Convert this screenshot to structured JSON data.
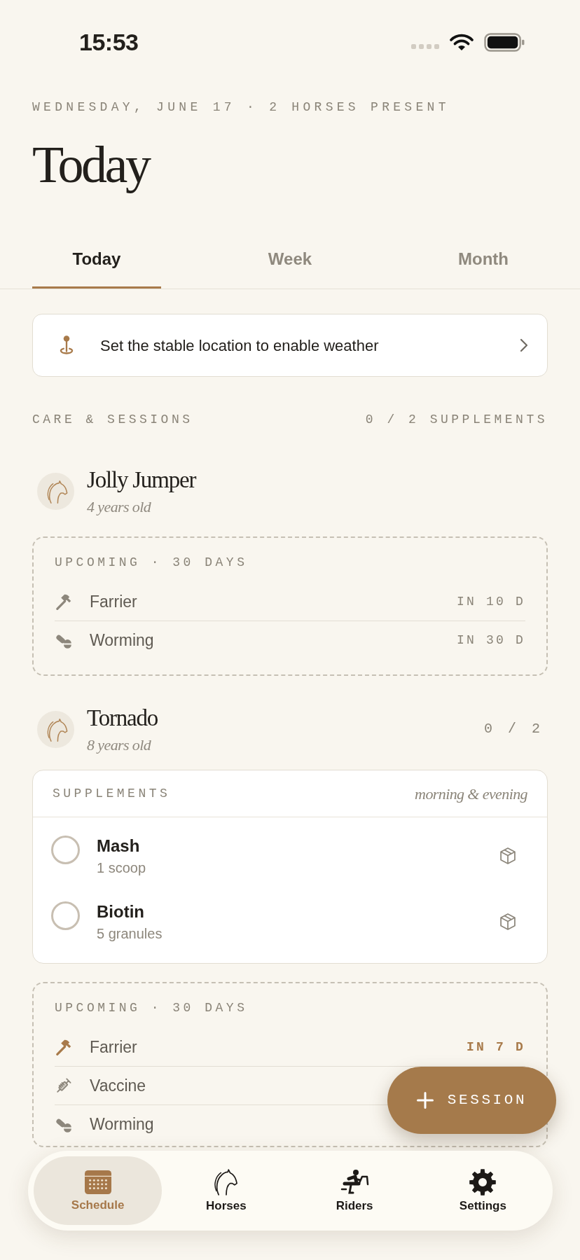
{
  "status_bar": {
    "time": "15:53"
  },
  "header": {
    "date_line": "WEDNESDAY, JUNE 17 · 2 HORSES PRESENT",
    "title": "Today"
  },
  "tabs": [
    {
      "label": "Today",
      "selected": true
    },
    {
      "label": "Week",
      "selected": false
    },
    {
      "label": "Month",
      "selected": false
    }
  ],
  "location_banner": {
    "text": "Set the stable location to enable weather"
  },
  "section": {
    "title": "CARE & SESSIONS",
    "summary": "0 / 2 SUPPLEMENTS"
  },
  "horses": [
    {
      "name": "Jolly Jumper",
      "age": "4 years old",
      "upcoming": {
        "title": "UPCOMING · 30 DAYS",
        "items": [
          {
            "kind": "farrier",
            "label": "Farrier",
            "due": "IN 10 D",
            "urgent": false
          },
          {
            "kind": "worming",
            "label": "Worming",
            "due": "IN 30 D",
            "urgent": false
          }
        ]
      }
    },
    {
      "name": "Tornado",
      "age": "8 years old",
      "count": "0 / 2",
      "supplements": {
        "title": "SUPPLEMENTS",
        "schedule": "morning & evening",
        "items": [
          {
            "name": "Mash",
            "amount": "1 scoop",
            "checked": false
          },
          {
            "name": "Biotin",
            "amount": "5 granules",
            "checked": false
          }
        ]
      },
      "upcoming": {
        "title": "UPCOMING · 30 DAYS",
        "items": [
          {
            "kind": "farrier",
            "label": "Farrier",
            "due": "IN 7 D",
            "urgent": true
          },
          {
            "kind": "vaccine",
            "label": "Vaccine",
            "urgent": false
          },
          {
            "kind": "worming",
            "label": "Worming",
            "urgent": false
          }
        ]
      }
    }
  ],
  "fab": {
    "label": "SESSION"
  },
  "tab_bar": [
    {
      "kind": "schedule",
      "label": "Schedule",
      "selected": true
    },
    {
      "kind": "horses",
      "label": "Horses",
      "selected": false
    },
    {
      "kind": "riders",
      "label": "Riders",
      "selected": false
    },
    {
      "kind": "settings",
      "label": "Settings",
      "selected": false
    }
  ]
}
